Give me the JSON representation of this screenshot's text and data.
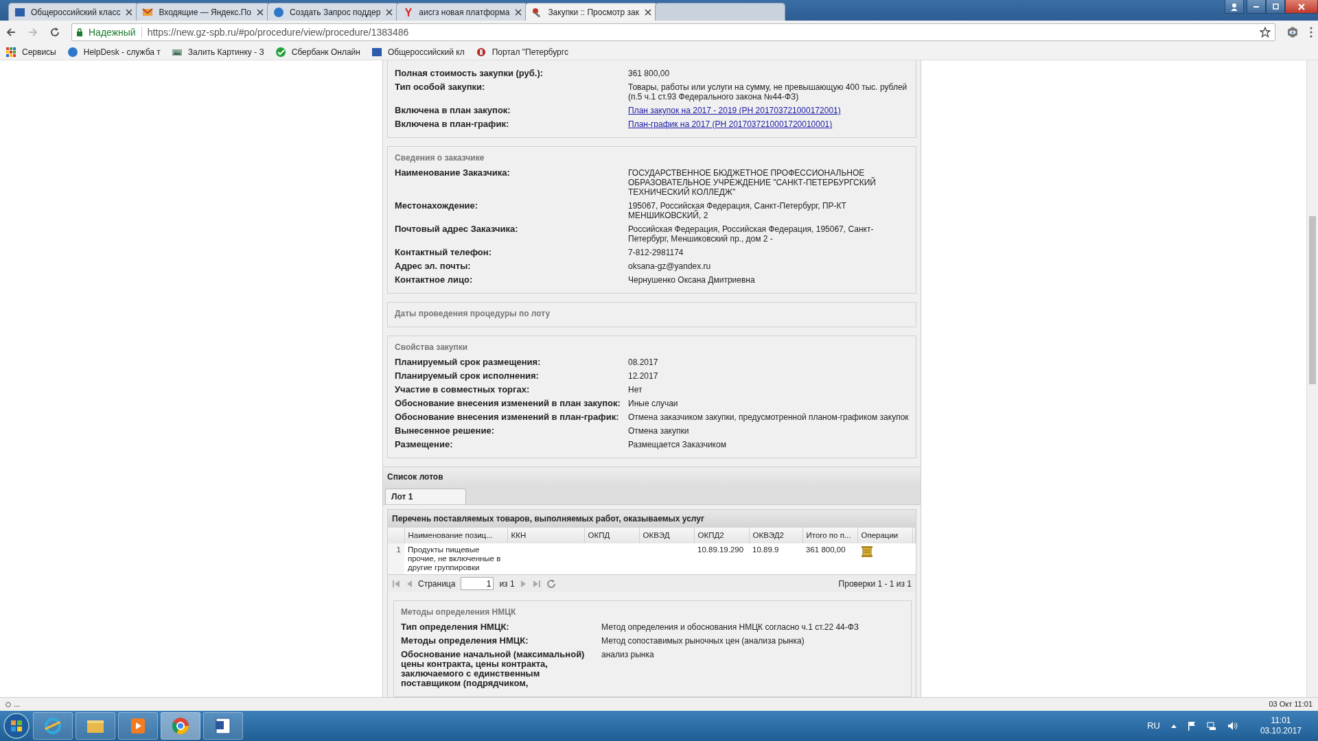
{
  "browser": {
    "tabs": [
      {
        "title": "Общероссийский класс",
        "selected": false
      },
      {
        "title": "Входящие — Яндекс.По",
        "selected": false
      },
      {
        "title": "Создать Запрос поддер",
        "selected": false
      },
      {
        "title": "аисгз новая платформа",
        "selected": false
      },
      {
        "title": "Закупки :: Просмотр зак",
        "selected": true
      }
    ],
    "security": "Надежный",
    "url": "https://new.gz-spb.ru/#po/procedure/view/procedure/1383486",
    "bookmarks": [
      "Сервисы",
      "HelpDesk - служба т",
      "Залить Картинку - З",
      "Сбербанк Онлайн",
      "Общероссийский кл",
      "Портал \"Петербургс"
    ]
  },
  "sections": [
    {
      "fields": [
        {
          "label": "Полная стоимость закупки (руб.):",
          "value": "361 800,00",
          "kind": "text"
        },
        {
          "label": "Тип особой закупки:",
          "value": "Товары, работы или услуги на сумму, не превышающую 400 тыс. рублей (п.5 ч.1 ст.93 Федерального закона №44-ФЗ)",
          "kind": "text"
        },
        {
          "label": "Включена в план закупок:",
          "value": "План закупок на 2017 - 2019 (РН 201703721000172001)",
          "kind": "link"
        },
        {
          "label": "Включена в план-график:",
          "value": "План-график на 2017 (РН 2017037210001720010001)",
          "kind": "link"
        }
      ]
    },
    {
      "legend": "Сведения о заказчике",
      "fields": [
        {
          "label": "Наименование Заказчика:",
          "value": "ГОСУДАРСТВЕННОЕ БЮДЖЕТНОЕ ПРОФЕССИОНАЛЬНОЕ ОБРАЗОВАТЕЛЬНОЕ УЧРЕЖДЕНИЕ \"САНКТ-ПЕТЕРБУРГСКИЙ ТЕХНИЧЕСКИЙ КОЛЛЕДЖ\"",
          "kind": "text"
        },
        {
          "label": "Местонахождение:",
          "value": "195067, Российская Федерация, Санкт-Петербург, ПР-КТ МЕНШИКОВСКИЙ, 2",
          "kind": "text"
        },
        {
          "label": "Почтовый адрес Заказчика:",
          "value": "Российская Федерация, Российская Федерация, 195067, Санкт-Петербург, Меншиковский пр., дом 2 -",
          "kind": "text"
        },
        {
          "label": "Контактный телефон:",
          "value": "7-812-2981174",
          "kind": "text"
        },
        {
          "label": "Адрес эл. почты:",
          "value": "oksana-gz@yandex.ru",
          "kind": "text"
        },
        {
          "label": "Контактное лицо:",
          "value": "Чернушенко Оксана Дмитриевна",
          "kind": "text"
        }
      ]
    },
    {
      "legend": "Даты проведения процедуры по лоту"
    },
    {
      "legend": "Свойства закупки",
      "fields": [
        {
          "label": "Планируемый срок размещения:",
          "value": "08.2017",
          "kind": "text"
        },
        {
          "label": "Планируемый срок исполнения:",
          "value": "12.2017",
          "kind": "text"
        },
        {
          "label": "Участие в совместных торгах:",
          "value": "Нет",
          "kind": "text"
        },
        {
          "label": "Обоснование внесения изменений в план закупок:",
          "value": "Иные случаи",
          "kind": "text"
        },
        {
          "label": "Обоснование внесения изменений в план-график:",
          "value": "Отмена заказчиком закупки, предусмотренной планом-графиком закупок",
          "kind": "text"
        },
        {
          "label": "Вынесенное решение:",
          "value": "Отмена закупки",
          "kind": "text"
        },
        {
          "label": "Размещение:",
          "value": "Размещается Заказчиком",
          "kind": "text"
        }
      ]
    }
  ],
  "lots": {
    "title": "Список лотов",
    "tabs": [
      {
        "label": "Лот 1",
        "selected": true
      }
    ],
    "grid_title": "Перечень поставляемых товаров, выполняемых работ, оказываемых услуг",
    "columns": [
      {
        "label": "Наименование позиц...",
        "kind": "text"
      },
      {
        "label": "ККН",
        "kind": "text"
      },
      {
        "label": "ОКПД",
        "kind": "text"
      },
      {
        "label": "ОКВЭД",
        "kind": "text"
      },
      {
        "label": "ОКПД2",
        "kind": "text"
      },
      {
        "label": "ОКВЭД2",
        "kind": "text"
      },
      {
        "label": "Итого по п...",
        "kind": "text"
      },
      {
        "label": "Операции",
        "kind": "operations"
      }
    ],
    "rows": [
      {
        "number": "1",
        "cells": [
          "Продукты пищевые прочие, не включенные в другие группировки",
          null,
          null,
          null,
          "10.89.19.290",
          "10.89.9",
          "361 800,00",
          null
        ]
      }
    ],
    "pager": {
      "page_label": "Страница",
      "page": "1",
      "of": "из 1",
      "summary": "Проверки 1 - 1 из 1"
    },
    "nmck": {
      "legend": "Методы определения НМЦК",
      "fields": [
        {
          "label": "Тип определения НМЦК:",
          "value": "Метод определения и обоснования НМЦК согласно ч.1 ст.22 44-ФЗ",
          "kind": "text"
        },
        {
          "label": "Методы определения НМЦК:",
          "value": "Метод сопоставимых рыночных цен (анализа рынка)",
          "kind": "text"
        },
        {
          "label": "Обоснование начальной (максимальной) цены контракта, цены контракта, заключаемого с единственным поставщиком (подрядчиком,",
          "value": "анализ рынка",
          "kind": "text"
        }
      ]
    }
  },
  "status_bar": {
    "left": "...",
    "right": "03 Окт 11:01"
  },
  "taskbar": {
    "language": "RU",
    "time": "11:01",
    "date": "03.10.2017"
  }
}
